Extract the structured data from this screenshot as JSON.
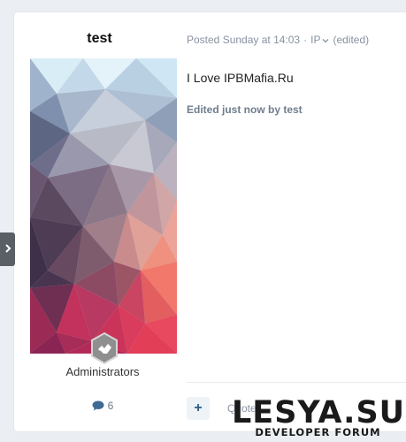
{
  "author": {
    "name": "test",
    "group": "Administrators",
    "post_count": "6"
  },
  "post": {
    "meta_posted": "Posted Sunday at 14:03",
    "meta_sep": "·",
    "meta_ip": "IP",
    "meta_edited": "(edited)",
    "body": "I Love IPBMafia.Ru",
    "edit_note": "Edited just now by test"
  },
  "footer": {
    "plus_label": "+",
    "quote_label": "Quote"
  },
  "watermark": {
    "title": "LESYA.SU",
    "subtitle": "DEVELOPER FORUM"
  },
  "colors": {
    "page_background": "#ebeef2",
    "card_background": "#ffffff",
    "meta_text": "#8792a2",
    "accent": "#2b5c8a"
  }
}
